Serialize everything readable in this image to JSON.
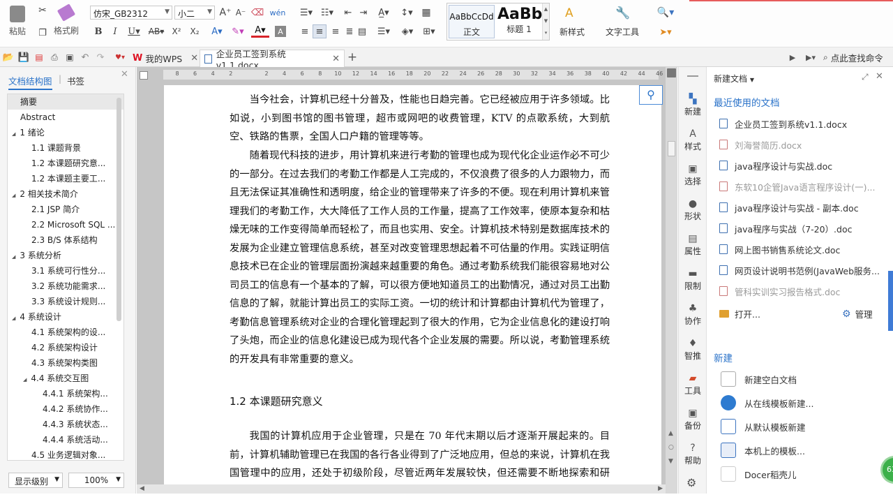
{
  "ribbon": {
    "paste": "粘贴",
    "format_painter": "格式刷",
    "font_name": "仿宋_GB2312",
    "font_size": "小二",
    "styles": [
      {
        "preview": "AaBbCcDd",
        "name": "正文"
      },
      {
        "preview": "AaBb",
        "name": "标题 1"
      }
    ],
    "new_style": "新样式",
    "text_tools": "文字工具"
  },
  "tabs": {
    "my_wps": "我的WPS",
    "doc_title": "企业员工签到系统v1.1.docx",
    "search_command": "点此查找命令"
  },
  "left_panel": {
    "tab_outline": "文档结构图",
    "tab_bookmark": "书签",
    "items": [
      {
        "label": "摘要",
        "indent": 0,
        "arrow": ""
      },
      {
        "label": "Abstract",
        "indent": 0,
        "arrow": ""
      },
      {
        "label": "1 绪论",
        "indent": 0,
        "arrow": "◢"
      },
      {
        "label": "1.1  课题背景",
        "indent": 1,
        "arrow": ""
      },
      {
        "label": "1.2  本课题研究意...",
        "indent": 1,
        "arrow": ""
      },
      {
        "label": "1.2  本课题主要工...",
        "indent": 1,
        "arrow": ""
      },
      {
        "label": "2  相关技术简介",
        "indent": 0,
        "arrow": "◢"
      },
      {
        "label": "2.1 JSP 简介",
        "indent": 1,
        "arrow": ""
      },
      {
        "label": "2.2 Microsoft SQL ...",
        "indent": 1,
        "arrow": ""
      },
      {
        "label": "2.3 B/S 体系结构",
        "indent": 1,
        "arrow": ""
      },
      {
        "label": "3  系统分析",
        "indent": 0,
        "arrow": "◢"
      },
      {
        "label": "3.1  系统可行性分...",
        "indent": 1,
        "arrow": ""
      },
      {
        "label": "3.2  系统功能需求...",
        "indent": 1,
        "arrow": ""
      },
      {
        "label": "3.3  系统设计规则...",
        "indent": 1,
        "arrow": ""
      },
      {
        "label": "4  系统设计",
        "indent": 0,
        "arrow": "◢"
      },
      {
        "label": "4.1  系统架构的设...",
        "indent": 1,
        "arrow": ""
      },
      {
        "label": "4.2  系统架构设计",
        "indent": 1,
        "arrow": ""
      },
      {
        "label": "4.3  系统架构类图",
        "indent": 1,
        "arrow": ""
      },
      {
        "label": "4.4  系统交互图",
        "indent": 1,
        "arrow": "◢"
      },
      {
        "label": "4.4.1  系统架构...",
        "indent": 2,
        "arrow": ""
      },
      {
        "label": "4.4.2  系统协作...",
        "indent": 2,
        "arrow": ""
      },
      {
        "label": "4.4.3  系统状态...",
        "indent": 2,
        "arrow": ""
      },
      {
        "label": "4.4.4  系统活动...",
        "indent": 2,
        "arrow": ""
      },
      {
        "label": "4.5  业务逻辑对象...",
        "indent": 1,
        "arrow": ""
      }
    ],
    "display_level": "显示级别",
    "zoom": "100%"
  },
  "document": {
    "para1": "当今社会，计算机已经十分普及，性能也日趋完善。它已经被应用于许多领域。比如说，小到图书馆的图书管理，超市或网吧的收费管理，KTV 的点歌系统，大到航空、铁路的售票，全国人口户籍的管理等等。",
    "para2": "随着现代科技的进步，用计算机来进行考勤的管理也成为现代化企业运作必不可少的一部分。在过去我们的考勤工作都是人工完成的，不仅浪费了很多的人力跟物力，而且无法保证其准确性和透明度，给企业的管理带来了许多的不便。现在利用计算机来管理我们的考勤工作，大大降低了工作人员的工作量，提高了工作效率，使原本复杂和枯燥无味的工作变得简单而轻松了，而且也实用、安全。计算机技术特别是数据库技术的发展为企业建立管理信息系统，甚至对改变管理思想起着不可估量的作用。实践证明信息技术已在企业的管理层面扮演越来越重要的角色。通过考勤系统我们能很容易地对公司员工的信息有一个基本的了解，可以很方便地知道员工的出勤情况，通过对员工出勤信息的了解，就能计算出员工的实际工资。一切的统计和计算都由计算机代为管理了，考勤信息管理系统对企业的合理化管理起到了很大的作用，它为企业信息化的建设打响了头炮，而企业的信息化建设已成为现代各个企业发展的需要。所以说，考勤管理系统的开发具有非常重要的意义。",
    "heading": "1.2  本课题研究意义",
    "para3": "我国的计算机应用于企业管理，只是在 70 年代末期以后才逐渐开展起来的。目前，计算机辅助管理已在我国的各行各业得到了广泛地应用，但总的来说，计算机在我国管理中的应用，还处于初级阶段，尽管近两年发展较快，但还需要不断地探索和研究。尤"
  },
  "side_strip": [
    "新建",
    "样式",
    "选择",
    "形状",
    "属性",
    "限制",
    "协作",
    "智推",
    "工具",
    "备份",
    "帮助"
  ],
  "right_panel": {
    "title": "新建文档",
    "recent_title": "最近使用的文档",
    "recent": [
      {
        "name": "企业员工签到系统v1.1.docx",
        "grey": false
      },
      {
        "name": "刘海誉简历.docx",
        "grey": true
      },
      {
        "name": "java程序设计与实战.doc",
        "grey": false
      },
      {
        "name": "东软10企管Java语言程序设计(一)...",
        "grey": true
      },
      {
        "name": "java程序设计与实战 - 副本.doc",
        "grey": false
      },
      {
        "name": "java程序与实战（7-20）.doc",
        "grey": false
      },
      {
        "name": "网上图书销售系统论文.doc",
        "grey": false
      },
      {
        "name": "网页设计说明书范例(JavaWeb服务...",
        "grey": false
      },
      {
        "name": "管科实训实习报告格式.doc",
        "grey": true
      }
    ],
    "open": "打开...",
    "manage": "管理",
    "new_title": "新建",
    "new_items": [
      "新建空白文档",
      "从在线模板新建...",
      "从默认模板新建",
      "本机上的模板...",
      "Docer稻壳儿"
    ],
    "badge": "63"
  },
  "ruler_ticks": [
    "8",
    "6",
    "4",
    "2",
    "",
    "2",
    "4",
    "6",
    "8",
    "10",
    "12",
    "14",
    "16",
    "18",
    "20",
    "22",
    "24",
    "26",
    "28",
    "30",
    "32",
    "34",
    "36",
    "38",
    "40",
    "42",
    "44",
    "46"
  ]
}
